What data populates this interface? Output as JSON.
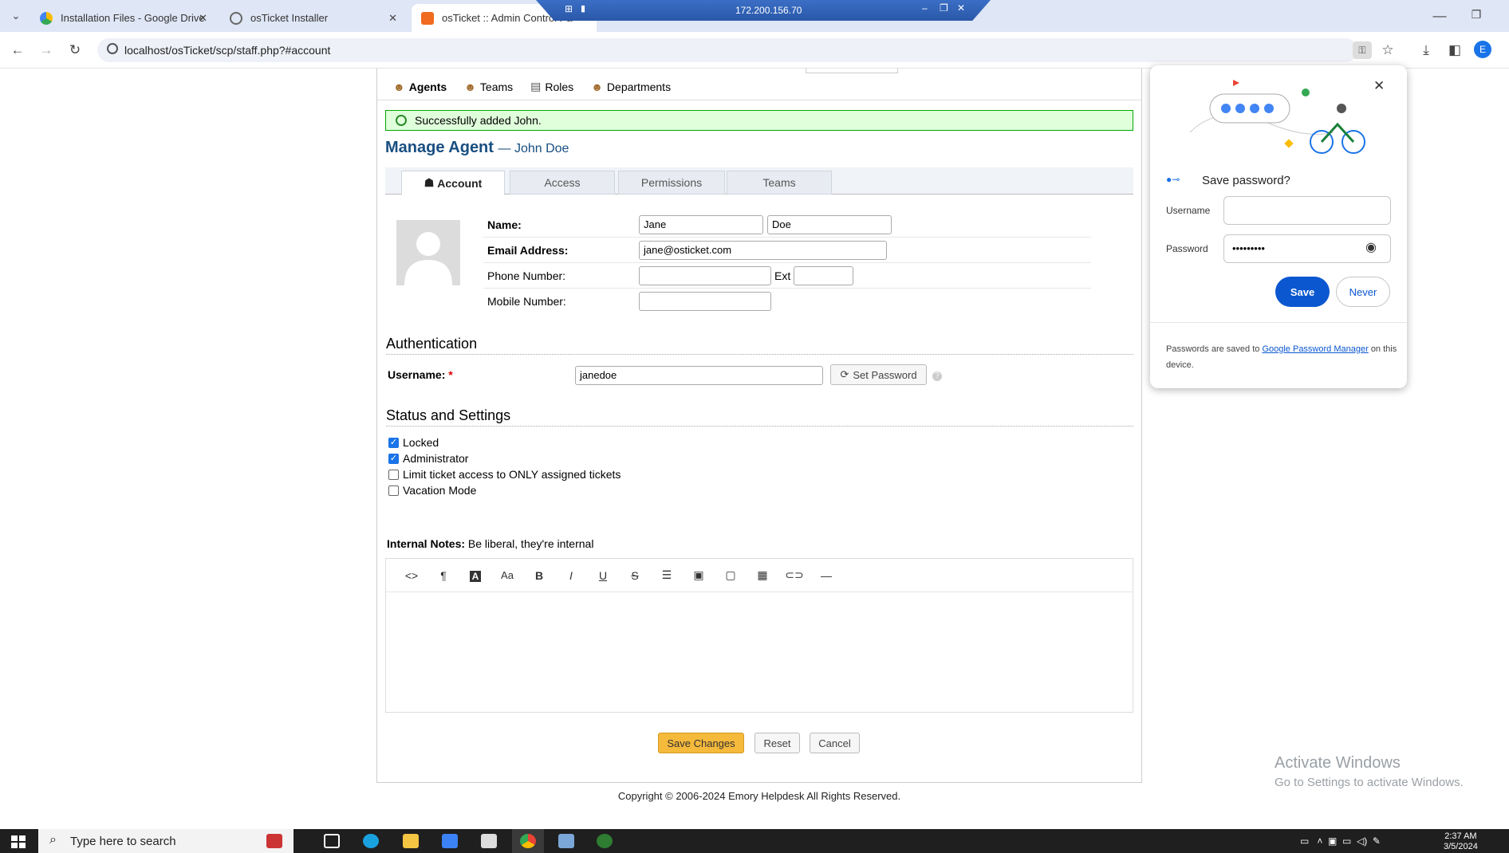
{
  "browser": {
    "tabs": [
      {
        "title": "Installation Files - Google Drive"
      },
      {
        "title": "osTicket Installer"
      },
      {
        "title": "osTicket :: Admin Control Pa"
      }
    ],
    "url": "localhost/osTicket/scp/staff.php?#account",
    "rdp_ip": "172.200.156.70",
    "profile_initial": "E"
  },
  "subnav": {
    "items": [
      "Agents",
      "Teams",
      "Roles",
      "Departments"
    ]
  },
  "alert": "Successfully added John.",
  "header": {
    "title": "Manage Agent",
    "subtitle": "— John Doe"
  },
  "form_tabs": [
    "Account",
    "Access",
    "Permissions",
    "Teams"
  ],
  "account": {
    "name_label": "Name:",
    "first_name": "Jane",
    "last_name": "Doe",
    "email_label": "Email Address:",
    "email": "jane@osticket.com",
    "phone_label": "Phone Number:",
    "ext_label": "Ext",
    "mobile_label": "Mobile Number:"
  },
  "auth": {
    "section": "Authentication",
    "username_label": "Username:",
    "required": "*",
    "username": "janedoe",
    "set_password": "Set Password"
  },
  "status": {
    "section": "Status and Settings",
    "options": [
      {
        "label": "Locked",
        "checked": true
      },
      {
        "label": "Administrator",
        "checked": true
      },
      {
        "label": "Limit ticket access to ONLY assigned tickets",
        "checked": false
      },
      {
        "label": "Vacation Mode",
        "checked": false
      }
    ]
  },
  "notes": {
    "label": "Internal Notes:",
    "hint": "Be liberal, they're internal"
  },
  "buttons": {
    "save": "Save Changes",
    "reset": "Reset",
    "cancel": "Cancel"
  },
  "footer": "Copyright © 2006-2024 Emory Helpdesk All Rights Reserved.",
  "password_popup": {
    "title": "Save password?",
    "username_label": "Username",
    "password_label": "Password",
    "password_value": "•••••••••",
    "save": "Save",
    "never": "Never",
    "note_prefix": "Passwords are saved to",
    "note_link": "Google Password Manager",
    "note_suffix": "on this device."
  },
  "watermark": {
    "line1": "Activate Windows",
    "line2": "Go to Settings to activate Windows."
  },
  "taskbar": {
    "search_placeholder": "Type here to search",
    "time": "2:37 AM",
    "date": "3/5/2024"
  }
}
